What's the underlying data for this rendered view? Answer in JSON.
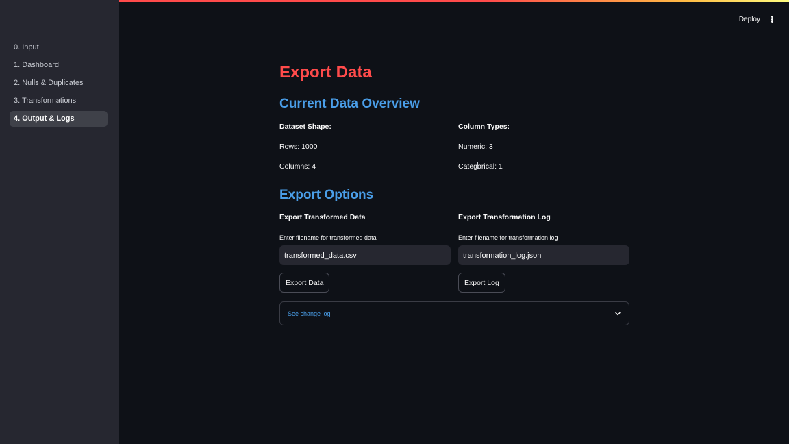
{
  "sidebar": {
    "items": [
      {
        "label": "0. Input"
      },
      {
        "label": "1. Dashboard"
      },
      {
        "label": "2. Nulls & Duplicates"
      },
      {
        "label": "3. Transformations"
      },
      {
        "label": "4. Output & Logs",
        "active": true
      }
    ]
  },
  "header": {
    "deploy_label": "Deploy",
    "menu_icon": "kebab-menu-icon"
  },
  "main": {
    "title": "Export Data",
    "overview": {
      "heading": "Current Data Overview",
      "shape_label": "Dataset Shape:",
      "rows": "Rows: 1000",
      "columns": "Columns: 4",
      "types_label": "Column Types:",
      "numeric": "Numeric: 3",
      "categorical": "Categorical: 1"
    },
    "export": {
      "heading": "Export Options",
      "data": {
        "heading": "Export Transformed Data",
        "input_label": "Enter filename for transformed data",
        "input_value": "transformed_data.csv",
        "button_label": "Export Data"
      },
      "log": {
        "heading": "Export Transformation Log",
        "input_label": "Enter filename for transformation log",
        "input_value": "transformation_log.json",
        "button_label": "Export Log"
      }
    },
    "expander": {
      "label": "See change log",
      "icon": "chevron-down-icon"
    }
  },
  "colors": {
    "accent_red": "#ff4b4b",
    "heading_blue": "#4a9ee8",
    "background": "#0e1117",
    "sidebar": "#262730"
  }
}
